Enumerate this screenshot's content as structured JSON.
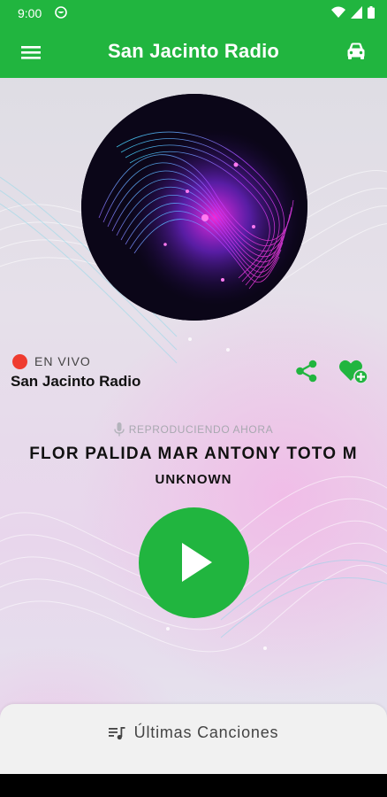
{
  "status_bar": {
    "time": "9:00"
  },
  "app_bar": {
    "title": "San Jacinto Radio"
  },
  "station": {
    "live_label": "EN VIVO",
    "name": "San Jacinto Radio"
  },
  "now_playing": {
    "label": "REPRODUCIENDO AHORA",
    "title": "FLOR PALIDA MAR ANTONY TOTO M",
    "artist": "UNKNOWN"
  },
  "recent": {
    "label": "Últimas Canciones"
  },
  "colors": {
    "accent": "#21b53f",
    "live": "#ef3b2f"
  },
  "icons": [
    "menu-icon",
    "car-icon",
    "share-icon",
    "favorite-add-icon",
    "microphone-icon",
    "play-icon",
    "playlist-icon"
  ]
}
